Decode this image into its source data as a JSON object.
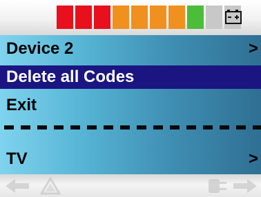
{
  "status": {
    "level_segments": [
      {
        "color": "#e8101c"
      },
      {
        "color": "#e8101c"
      },
      {
        "color": "#e8101c"
      },
      {
        "color": "#f0901e"
      },
      {
        "color": "#f0901e"
      },
      {
        "color": "#f0901e"
      },
      {
        "color": "#f0901e"
      },
      {
        "color": "#4bbd39"
      },
      {
        "color": "#c8c8c8"
      },
      {
        "color": "#c8c8c8"
      }
    ],
    "battery_icon": "battery-icon"
  },
  "menu": {
    "items": [
      {
        "label": "Device 2",
        "submenu": ">",
        "selected": false
      },
      {
        "label": "Delete all Codes",
        "selected": true
      },
      {
        "label": "Exit",
        "selected": false
      }
    ],
    "tv_item": {
      "label": "TV",
      "submenu": ">"
    }
  },
  "bottom_icons": [
    "back-arrow-icon",
    "warning-icon",
    "plug-icon",
    "forward-arrow-icon"
  ],
  "colors": {
    "highlight": "#1a1580"
  }
}
